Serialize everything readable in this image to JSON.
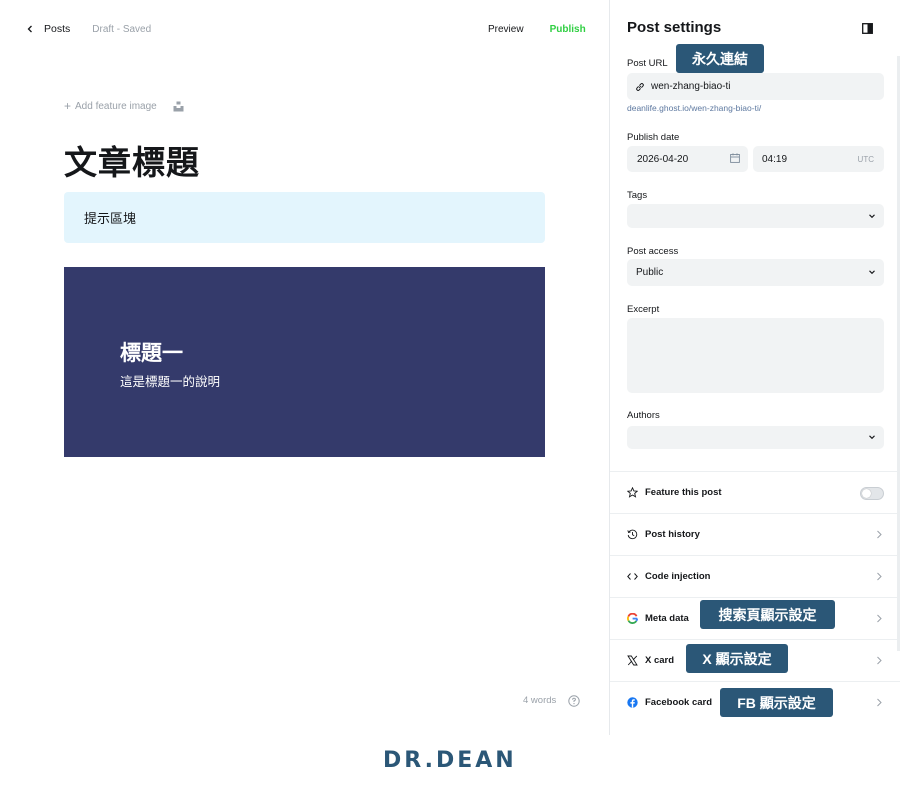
{
  "editor": {
    "back_label": "Posts",
    "draft_status": "Draft - Saved",
    "preview_label": "Preview",
    "publish_label": "Publish",
    "add_feature_image": "Add feature image",
    "title": "文章標題",
    "callout_text": "提示區塊",
    "header_card": {
      "title": "標題一",
      "subtitle": "這是標題一的說明"
    },
    "word_count": "4 words",
    "colors": {
      "publish": "#30cf43",
      "callout_bg": "#e3f5fd",
      "header_bg": "#343a6b"
    }
  },
  "settings": {
    "title": "Post settings",
    "post_url": {
      "label": "Post URL",
      "value": "wen-zhang-biao-ti",
      "hint": "deanlife.ghost.io/wen-zhang-biao-ti/"
    },
    "publish_date": {
      "label": "Publish date",
      "date": "2026-04-20",
      "time": "04:19",
      "tz": "UTC"
    },
    "tags": {
      "label": "Tags",
      "value": ""
    },
    "post_access": {
      "label": "Post access",
      "value": "Public"
    },
    "excerpt": {
      "label": "Excerpt",
      "value": ""
    },
    "authors": {
      "label": "Authors",
      "value": ""
    },
    "rows": {
      "feature": "Feature this post",
      "history": "Post history",
      "code_injection": "Code injection",
      "meta_data": "Meta data",
      "x_card": "X card",
      "facebook_card": "Facebook card"
    },
    "feature_enabled": false
  },
  "annotations": {
    "permalink": "永久連結",
    "search_display": "搜索頁顯示設定",
    "x_display": "X 顯示設定",
    "fb_display": "FB 顯示設定"
  },
  "logo": {
    "text": "DR.DEAN",
    "color": "#2b5777"
  }
}
